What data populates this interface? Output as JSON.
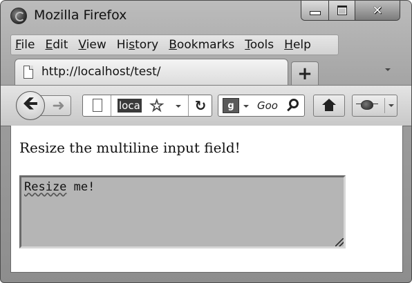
{
  "window": {
    "title": "Mozilla Firefox",
    "buttons": {
      "minimize": "",
      "maximize": "",
      "close": "✕"
    }
  },
  "menu": {
    "items": [
      {
        "underline": "F",
        "rest": "ile"
      },
      {
        "underline": "E",
        "rest": "dit"
      },
      {
        "underline": "V",
        "rest": "iew"
      },
      {
        "pre": "Hi",
        "underline": "s",
        "rest": "tory"
      },
      {
        "underline": "B",
        "rest": "ookmarks"
      },
      {
        "underline": "T",
        "rest": "ools"
      },
      {
        "underline": "H",
        "rest": "elp"
      }
    ]
  },
  "tab": {
    "label": "http://localhost/test/",
    "new_tab_label": "+"
  },
  "navigation": {
    "back_glyph": "🡸",
    "forward_glyph": "➜",
    "url_visible": "loca",
    "star_glyph": "☆",
    "reload_glyph": "↻",
    "search_engine_glyph": "g",
    "search_placeholder": "Goo"
  },
  "page": {
    "heading": "Resize the multiline input field!",
    "textarea": {
      "first_word": "Resize",
      "rest": " me!"
    }
  },
  "icons": {
    "app": "firefox-icon",
    "page": "page-icon",
    "star": "star-icon",
    "reload": "reload-icon",
    "search": "magnifier-icon",
    "home": "home-icon",
    "addon": "bug-icon",
    "grip": "resize-grip-icon"
  }
}
